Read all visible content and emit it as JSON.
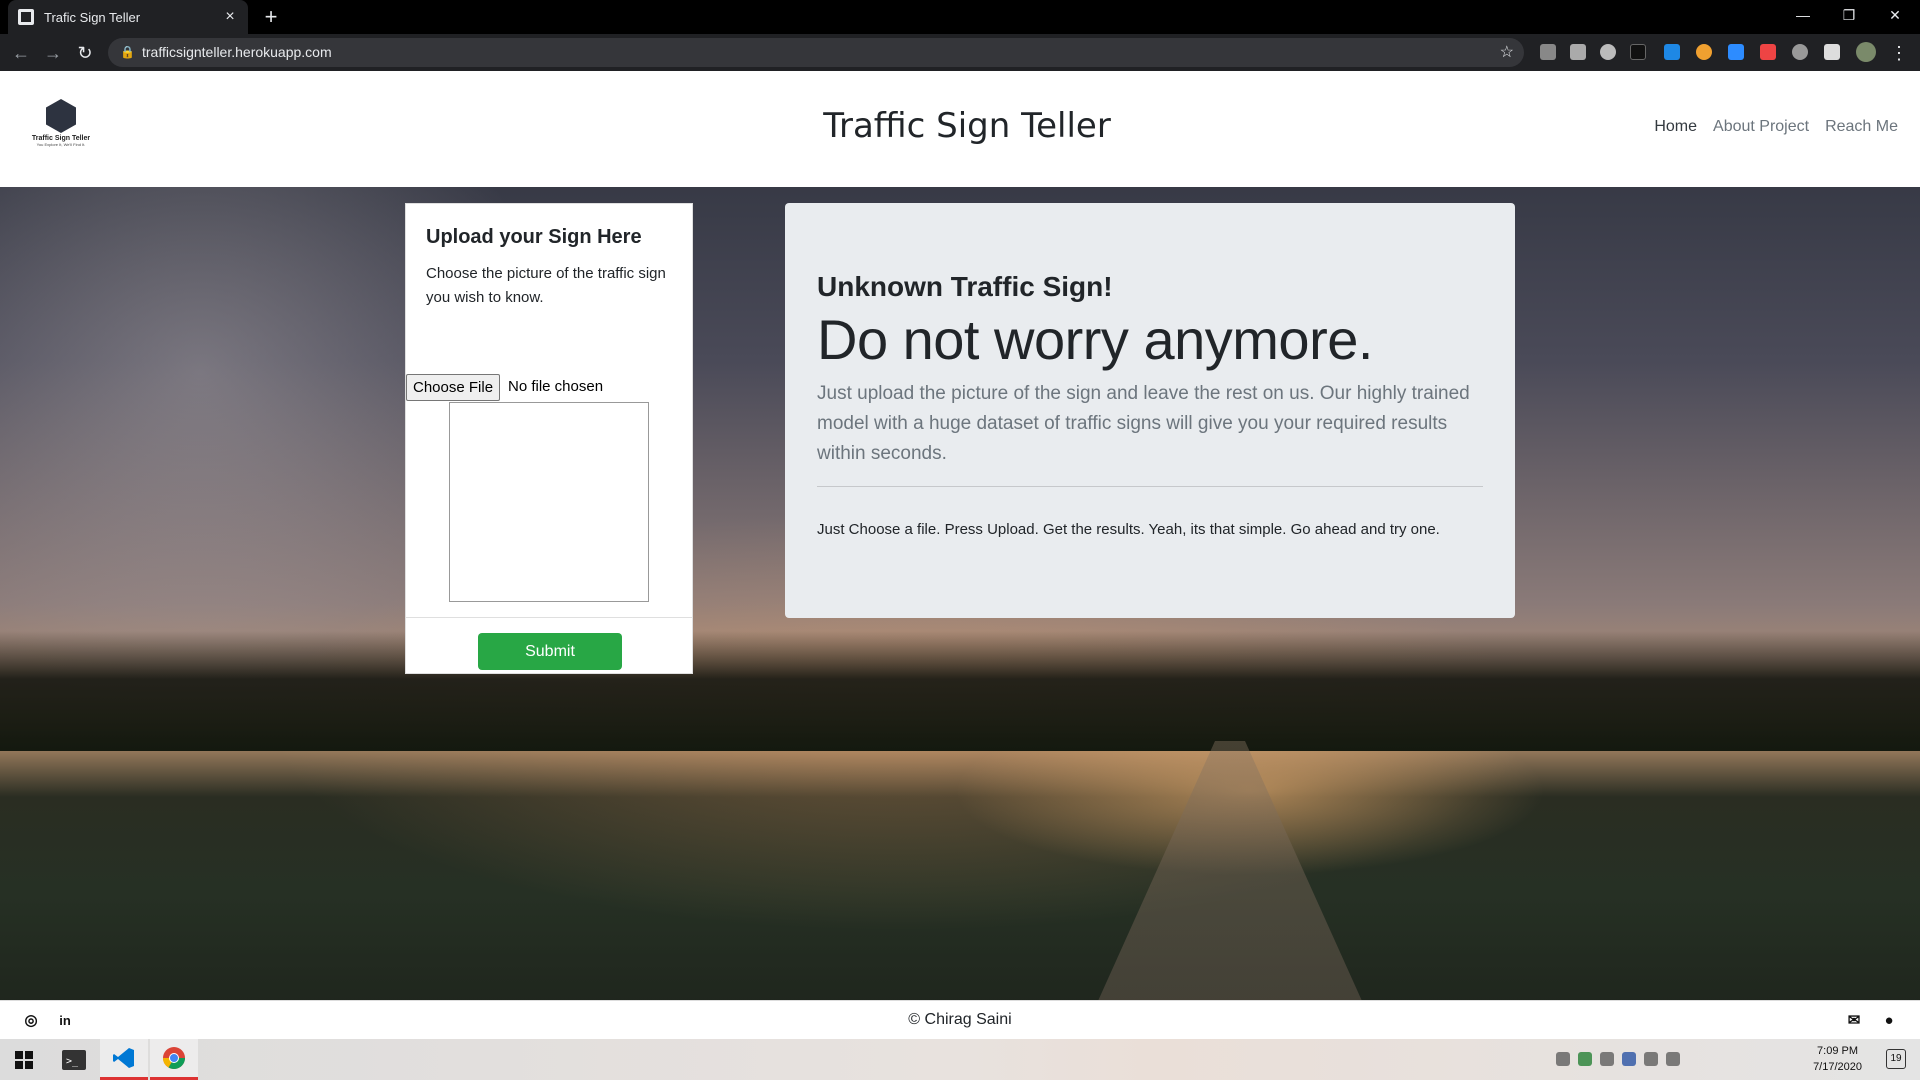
{
  "browser": {
    "tab_title": "Trafic Sign Teller",
    "url": "trafficsignteller.herokuapp.com"
  },
  "header": {
    "logo_title": "Traffic Sign Teller",
    "logo_tagline": "You Explore It, We'll Find It.",
    "brand": "Traffic Sign Teller",
    "nav": [
      {
        "label": "Home"
      },
      {
        "label": "About Project"
      },
      {
        "label": "Reach Me"
      }
    ]
  },
  "upload_card": {
    "title": "Upload your Sign Here",
    "text": "Choose the picture of the traffic sign you wish to know.",
    "file_button": "Choose File",
    "file_status": "No file chosen",
    "submit_label": "Submit"
  },
  "hero": {
    "heading": "Unknown Traffic Sign!",
    "display": "Do not worry anymore.",
    "lead": "Just upload the picture of the sign and leave the rest on us. Our highly trained model with a huge dataset of traffic signs will give you your required results within seconds.",
    "note": "Just Choose a file. Press Upload. Get the results. Yeah, its that simple. Go ahead and try one."
  },
  "footer": {
    "copyright": "© Chirag Saini"
  },
  "taskbar": {
    "time": "7:09 PM",
    "date": "7/17/2020",
    "notification_count": "19"
  }
}
